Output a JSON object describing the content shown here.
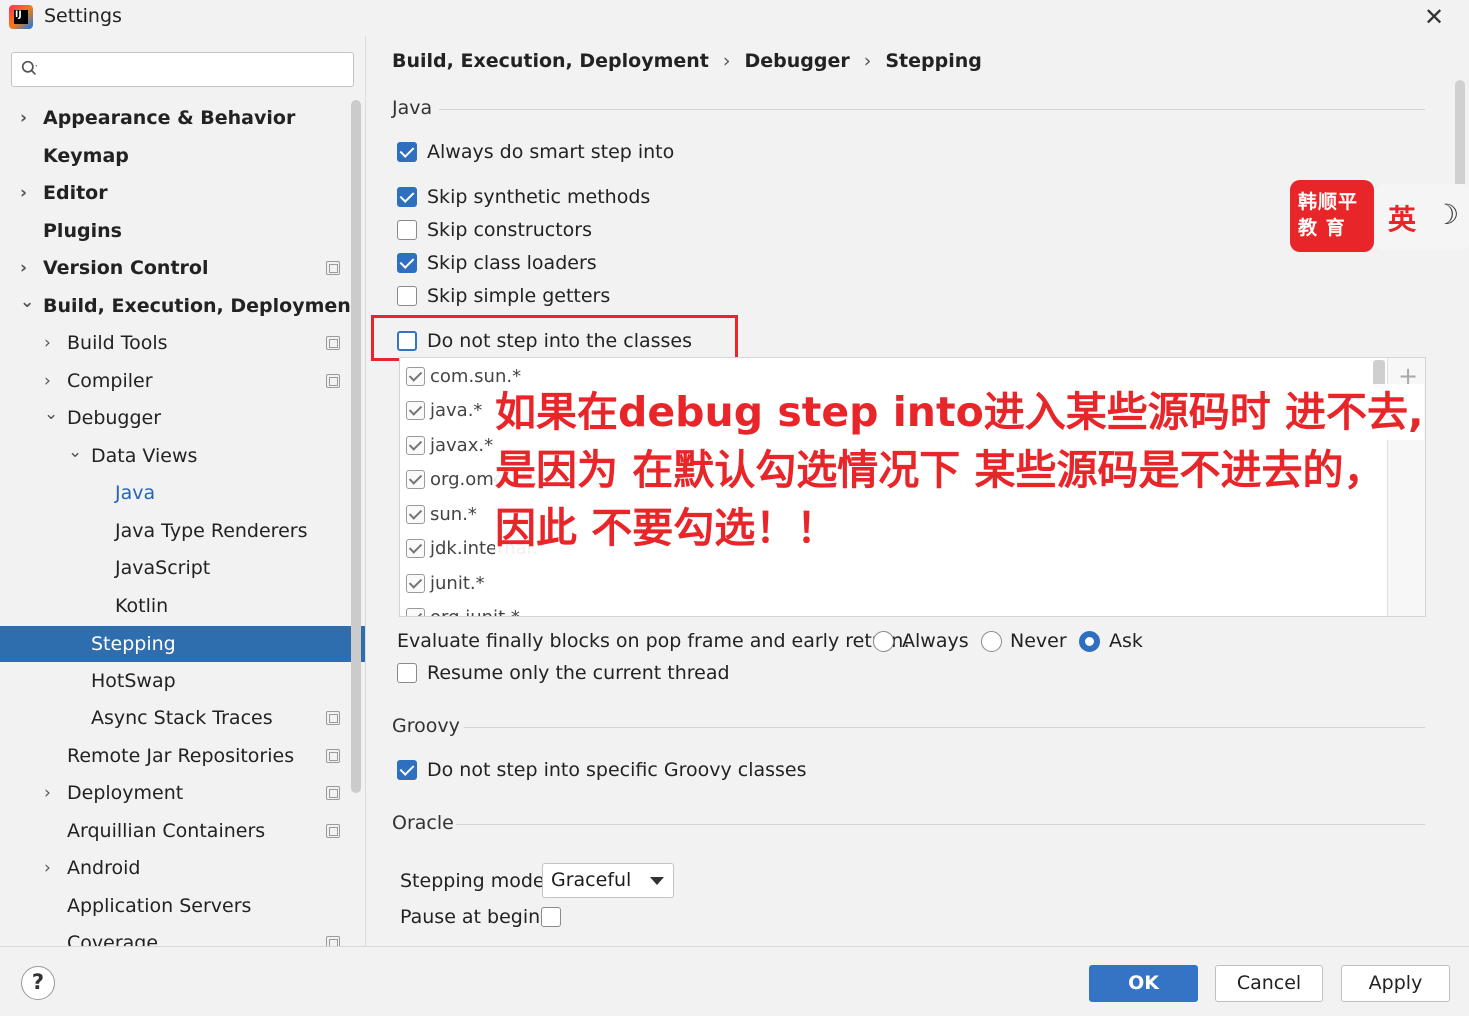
{
  "window": {
    "title": "Settings",
    "close": "✕"
  },
  "search": {
    "placeholder": "",
    "value": ""
  },
  "sidebar": {
    "items": [
      {
        "label": "Appearance & Behavior",
        "chevron": "›"
      },
      {
        "label": "Keymap",
        "chevron": ""
      },
      {
        "label": "Editor",
        "chevron": "›"
      },
      {
        "label": "Plugins",
        "chevron": ""
      },
      {
        "label": "Version Control",
        "chevron": "›"
      },
      {
        "label": "Build, Execution, Deployment",
        "chevron": "⌄"
      },
      {
        "label": "Build Tools",
        "chevron": "›"
      },
      {
        "label": "Compiler",
        "chevron": "›"
      },
      {
        "label": "Debugger",
        "chevron": "⌄"
      },
      {
        "label": "Data Views",
        "chevron": "⌄"
      },
      {
        "label": "Java",
        "chevron": ""
      },
      {
        "label": "Java Type Renderers",
        "chevron": ""
      },
      {
        "label": "JavaScript",
        "chevron": ""
      },
      {
        "label": "Kotlin",
        "chevron": ""
      },
      {
        "label": "Stepping",
        "chevron": ""
      },
      {
        "label": "HotSwap",
        "chevron": ""
      },
      {
        "label": "Async Stack Traces",
        "chevron": ""
      },
      {
        "label": "Remote Jar Repositories",
        "chevron": ""
      },
      {
        "label": "Deployment",
        "chevron": "›"
      },
      {
        "label": "Arquillian Containers",
        "chevron": ""
      },
      {
        "label": "Android",
        "chevron": "›"
      },
      {
        "label": "Application Servers",
        "chevron": ""
      },
      {
        "label": "Coverage",
        "chevron": ""
      }
    ]
  },
  "breadcrumb": [
    "Build, Execution, Deployment",
    "Debugger",
    "Stepping"
  ],
  "breadcrumb_sep": "›",
  "java": {
    "section": "Java",
    "smart_step": "Always do smart step into",
    "skip_synthetic": "Skip synthetic methods",
    "skip_constructors": "Skip constructors",
    "skip_class_loaders": "Skip class loaders",
    "skip_simple_getters": "Skip simple getters",
    "do_not_step": "Do not step into the classes",
    "classes": [
      "com.sun.*",
      "java.*",
      "javax.*",
      "org.omg.*",
      "sun.*",
      "jdk.internal.*",
      "junit.*",
      "org.junit.*"
    ],
    "add": "+",
    "evaluate_finally": "Evaluate finally blocks on pop frame and early return:",
    "radio_options": [
      "Always",
      "Never",
      "Ask"
    ],
    "radio_selected": "Ask",
    "resume_only": "Resume only the current thread"
  },
  "groovy": {
    "section": "Groovy",
    "do_not_step_groovy": "Do not step into specific Groovy classes"
  },
  "oracle": {
    "section": "Oracle",
    "stepping_mode_label": "Stepping mode:",
    "stepping_mode_value": "Graceful",
    "pause_at_begin": "Pause at begin:"
  },
  "annotation": {
    "line1": "如果在debug step into进入某些源码时 进不去,",
    "line2": "是因为 在默认勾选情况下 某些源码是不进去的，",
    "line3": "因此 不要勾选！！",
    "color": "#e8262a"
  },
  "badge": {
    "line1": "韩顺平",
    "line2": "教  育",
    "side": "英",
    "moon": "☽"
  },
  "buttons": {
    "help": "?",
    "ok": "OK",
    "cancel": "Cancel",
    "apply": "Apply"
  },
  "colors": {
    "accent": "#2f6fc0",
    "selection": "#2e6dae",
    "highlight_box": "#e8262a"
  }
}
